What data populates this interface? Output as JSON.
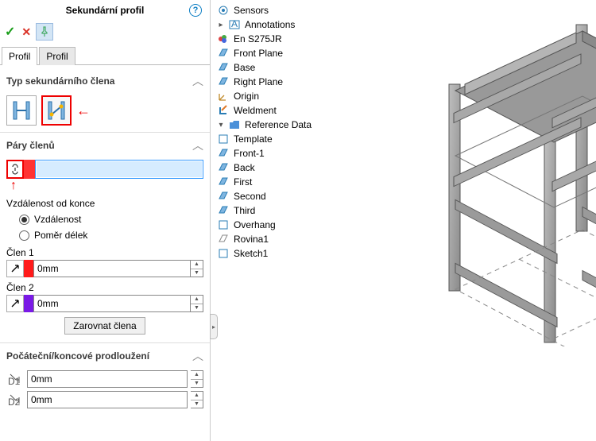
{
  "panel": {
    "title": "Sekundární profil",
    "help": "?",
    "ok": "✓",
    "cancel": "✕",
    "pin": "📌"
  },
  "tabs": {
    "t1": "Profil",
    "t2": "Profil"
  },
  "secType": {
    "title": "Typ sekundárního člena"
  },
  "pairs": {
    "title": "Páry členů",
    "distLabel": "Vzdálenost od konce",
    "optDist": "Vzdálenost",
    "optRatio": "Poměr délek"
  },
  "member1": {
    "label": "Člen 1",
    "value": "0mm"
  },
  "member2": {
    "label": "Člen 2",
    "value": "0mm"
  },
  "alignBtn": "Zarovnat člena",
  "extension": {
    "title": "Počáteční/koncové prodloužení",
    "v1": "0mm",
    "v2": "0mm"
  },
  "tree": {
    "sensors": "Sensors",
    "annotations": "Annotations",
    "material": "En S275JR",
    "frontPlane": "Front Plane",
    "base": "Base",
    "rightPlane": "Right Plane",
    "origin": "Origin",
    "weldment": "Weldment",
    "refData": "Reference Data",
    "template": "Template",
    "front1": "Front-1",
    "back": "Back",
    "first": "First",
    "second": "Second",
    "third": "Third",
    "overhang": "Overhang",
    "rovina1": "Rovina1",
    "sketch1": "Sketch1"
  }
}
